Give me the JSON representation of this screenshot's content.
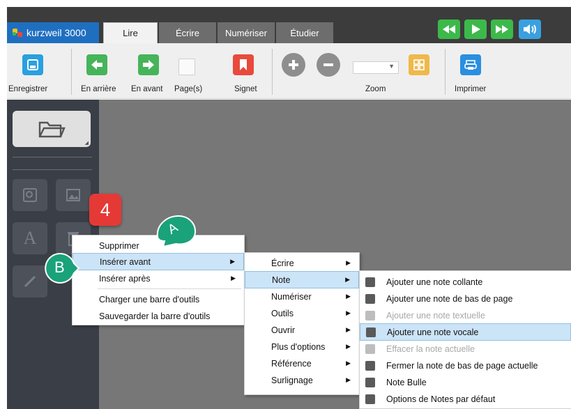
{
  "app": {
    "logo_text": "kurzweil 3000"
  },
  "tabs": [
    {
      "label": "Lire"
    },
    {
      "label": "Écrire"
    },
    {
      "label": "Numériser"
    },
    {
      "label": "Étudier"
    }
  ],
  "toolbar": {
    "save": "Enregistrer",
    "back": "En arrière",
    "forward": "En avant",
    "pages": "Page(s)",
    "bookmark": "Signet",
    "zoom": "Zoom",
    "print": "Imprimer"
  },
  "annotations": {
    "step": "4",
    "marker_a": "A",
    "marker_b": "B"
  },
  "menu1": [
    {
      "label": "Supprimer"
    },
    {
      "label": "Insérer avant"
    },
    {
      "label": "Insérer après"
    },
    {
      "label": "Charger une barre d'outils"
    },
    {
      "label": "Sauvegarder la barre d'outils"
    }
  ],
  "menu2": [
    {
      "label": "Écrire"
    },
    {
      "label": "Note"
    },
    {
      "label": "Numériser"
    },
    {
      "label": "Outils"
    },
    {
      "label": "Ouvrir"
    },
    {
      "label": "Plus d'options"
    },
    {
      "label": "Référence"
    },
    {
      "label": "Surlignage"
    }
  ],
  "menu3": [
    {
      "label": "Ajouter une note collante"
    },
    {
      "label": "Ajouter une note de bas de page"
    },
    {
      "label": "Ajouter une note textuelle"
    },
    {
      "label": "Ajouter une note vocale"
    },
    {
      "label": "Effacer la note actuelle"
    },
    {
      "label": "Fermer la note de bas de page actuelle"
    },
    {
      "label": "Note Bulle"
    },
    {
      "label": "Options de Notes par défaut"
    }
  ],
  "colors": {
    "green": "#3cb94a",
    "blue": "#3aa0e0",
    "red": "#e53935",
    "teal": "#1aa27a",
    "highlight": "#cce4f7"
  }
}
